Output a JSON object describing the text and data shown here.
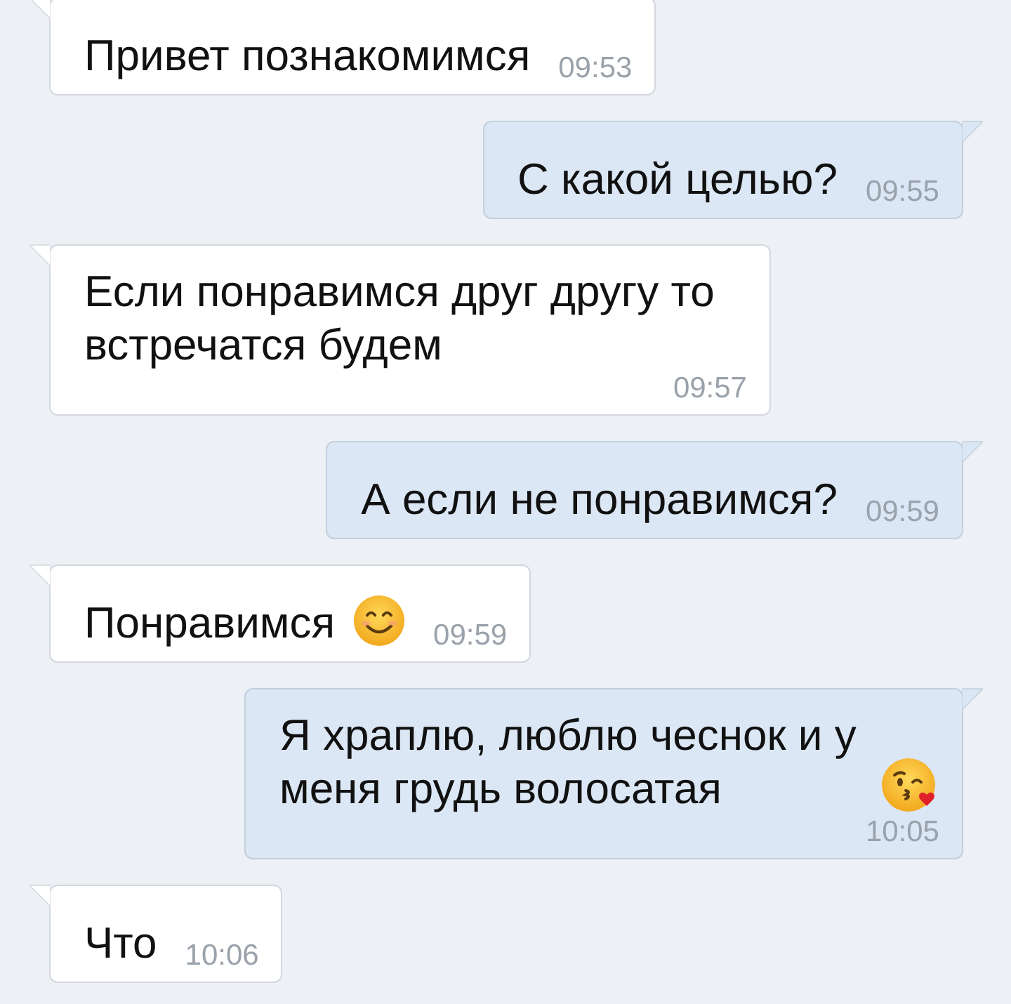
{
  "messages": [
    {
      "kind": "incoming",
      "text": "Привет познакомимся",
      "time": "09:53"
    },
    {
      "kind": "outgoing",
      "text": "С какой целью?",
      "time": "09:55"
    },
    {
      "kind": "incoming",
      "text": "Если понравимся друг другу то встречатся будем",
      "time": "09:57"
    },
    {
      "kind": "outgoing",
      "text": "А если не понравимся?",
      "time": "09:59"
    },
    {
      "kind": "incoming",
      "text": "Понравимся",
      "emoji": {
        "kind": "smile"
      },
      "time": "09:59"
    },
    {
      "kind": "outgoing",
      "text": "Я храплю, люблю чеснок и у меня грудь волосатая",
      "emoji": {
        "kind": "kiss"
      },
      "time": "10:05"
    },
    {
      "kind": "incoming",
      "text": "Что",
      "time": "10:06"
    }
  ]
}
